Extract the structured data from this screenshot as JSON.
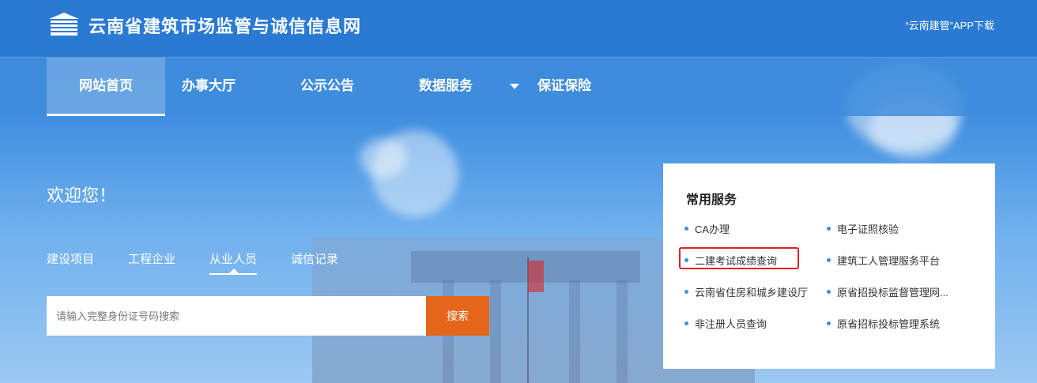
{
  "header": {
    "site_title": "云南省建筑市场监管与诚信信息网",
    "app_download": "“云南建管”APP下载"
  },
  "nav": {
    "items": [
      {
        "label": "网站首页"
      },
      {
        "label": "办事大厅"
      },
      {
        "label": "公示公告"
      },
      {
        "label": "数据服务"
      },
      {
        "label": "保证保险"
      }
    ]
  },
  "main": {
    "welcome": "欢迎您！",
    "tabs": [
      {
        "label": "建设项目"
      },
      {
        "label": "工程企业"
      },
      {
        "label": "从业人员"
      },
      {
        "label": "诚信记录"
      }
    ],
    "search": {
      "placeholder": "请输入完整身份证号码搜索",
      "button": "搜索"
    }
  },
  "services": {
    "title": "常用服务",
    "items": [
      {
        "label": "CA办理"
      },
      {
        "label": "电子证照核验"
      },
      {
        "label": "二建考试成绩查询"
      },
      {
        "label": "建筑工人管理服务平台"
      },
      {
        "label": "云南省住房和城乡建设厅"
      },
      {
        "label": "原省招投标监督管理网..."
      },
      {
        "label": "非注册人员查询"
      },
      {
        "label": "原省招标投标管理系统"
      }
    ]
  },
  "colors": {
    "header": "#2a7ad3",
    "search_button": "#e5651a",
    "bullet": "#3b8ee3",
    "highlight_border": "#e02020"
  }
}
